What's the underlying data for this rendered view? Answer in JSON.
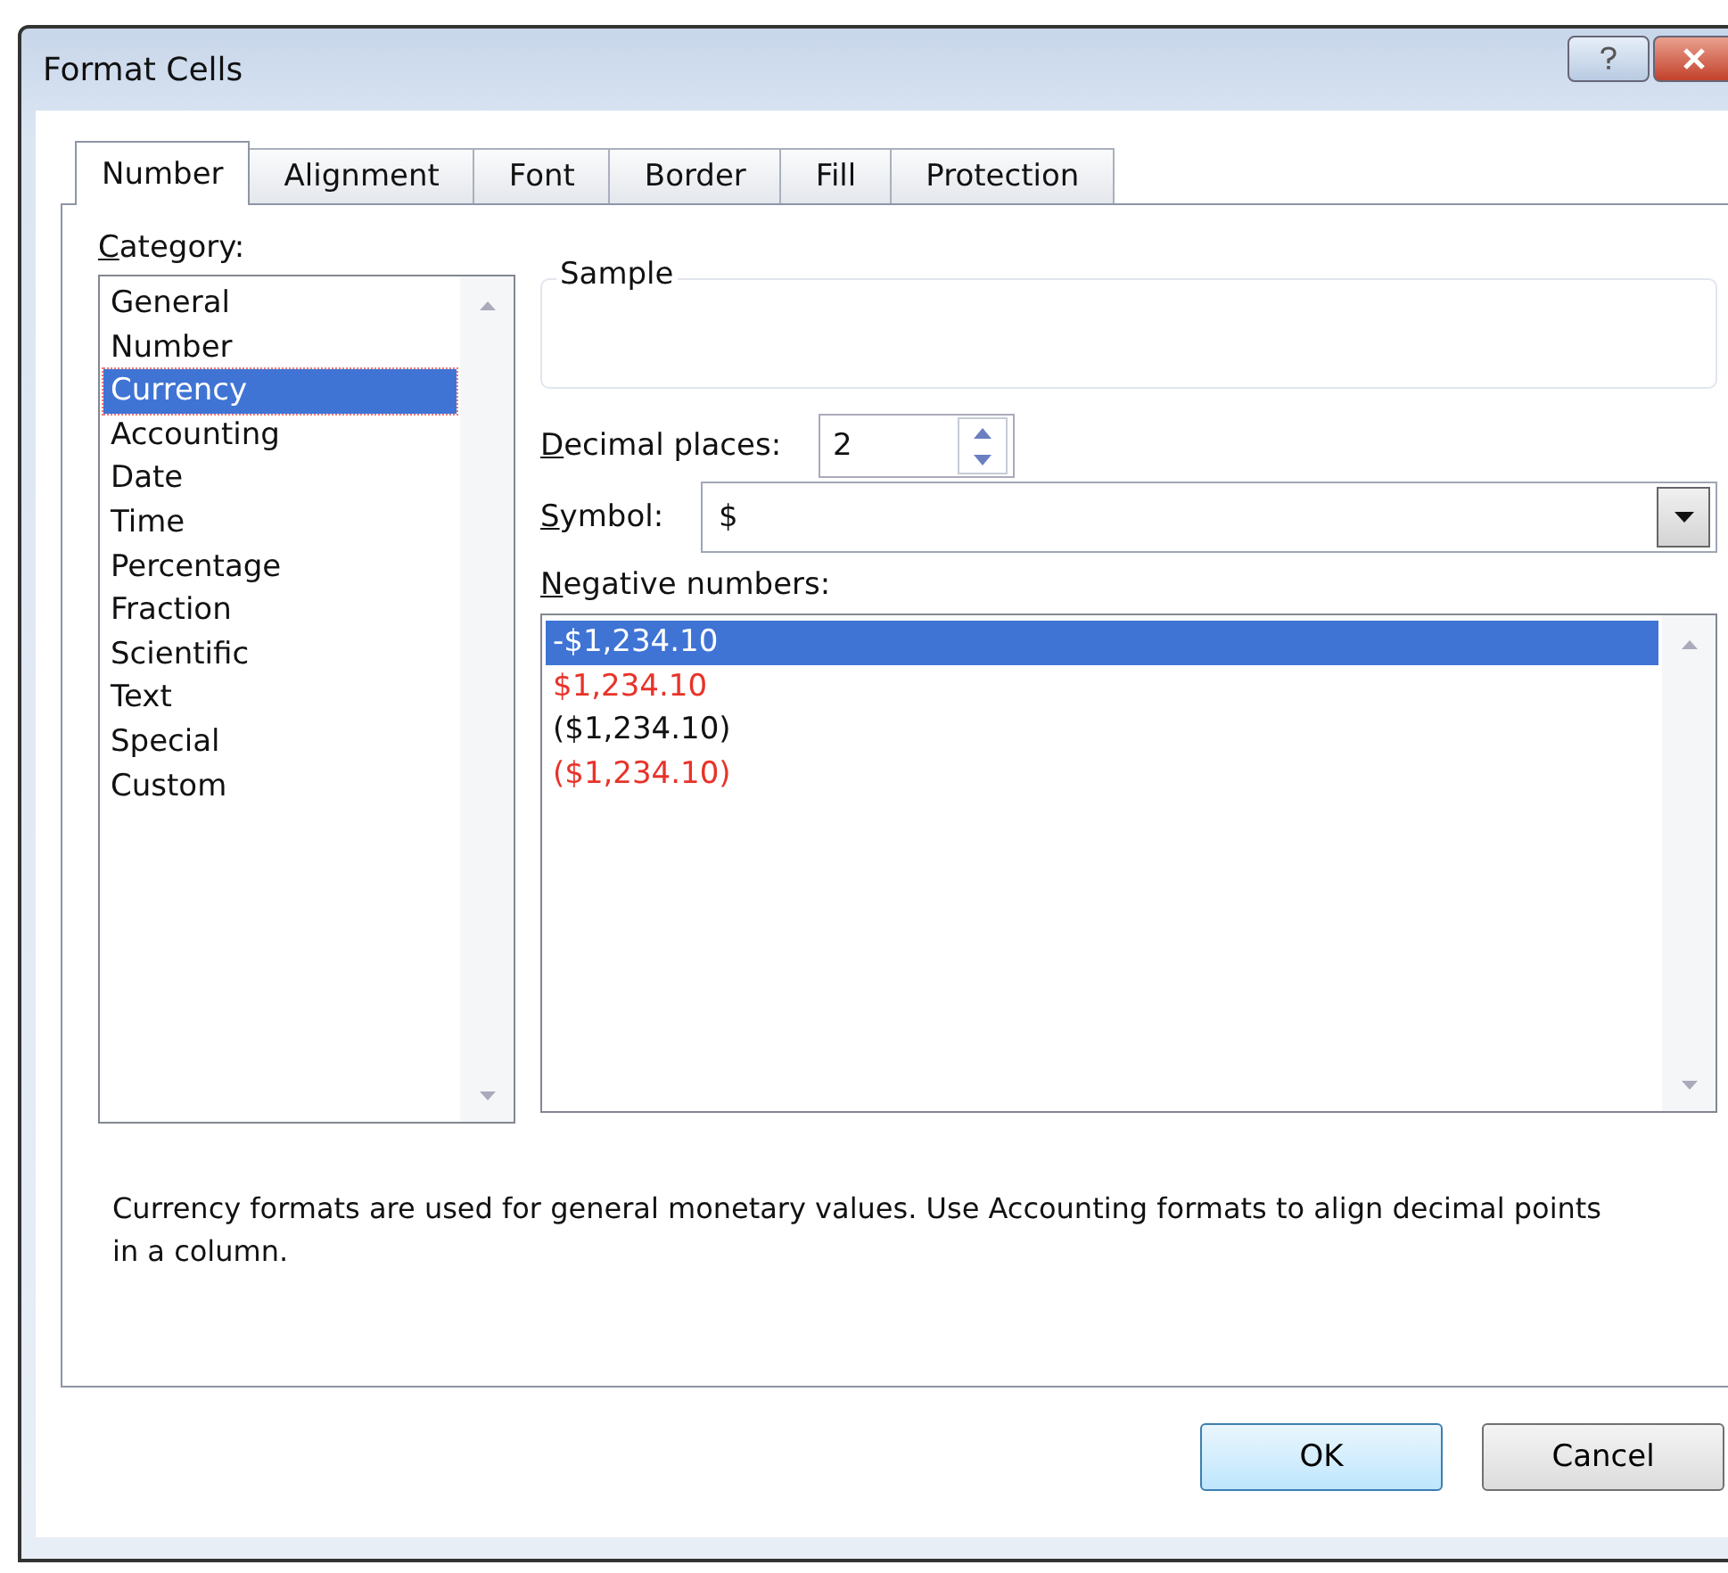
{
  "window": {
    "title": "Format Cells"
  },
  "tabs": [
    {
      "label": "Number",
      "selected": true
    },
    {
      "label": "Alignment",
      "selected": false
    },
    {
      "label": "Font",
      "selected": false
    },
    {
      "label": "Border",
      "selected": false
    },
    {
      "label": "Fill",
      "selected": false
    },
    {
      "label": "Protection",
      "selected": false
    }
  ],
  "category": {
    "label": "Category:",
    "items": [
      {
        "label": "General",
        "selected": false
      },
      {
        "label": "Number",
        "selected": false
      },
      {
        "label": "Currency",
        "selected": true
      },
      {
        "label": "Accounting",
        "selected": false
      },
      {
        "label": "Date",
        "selected": false
      },
      {
        "label": "Time",
        "selected": false
      },
      {
        "label": "Percentage",
        "selected": false
      },
      {
        "label": "Fraction",
        "selected": false
      },
      {
        "label": "Scientific",
        "selected": false
      },
      {
        "label": "Text",
        "selected": false
      },
      {
        "label": "Special",
        "selected": false
      },
      {
        "label": "Custom",
        "selected": false
      }
    ]
  },
  "sample": {
    "label": "Sample"
  },
  "decimal_places": {
    "label": "Decimal places:",
    "value": "2"
  },
  "symbol": {
    "label": "Symbol:",
    "value": "$"
  },
  "negative_numbers": {
    "label": "Negative numbers:",
    "items": [
      {
        "label": "-$1,234.10",
        "selected": true,
        "kind": "plain"
      },
      {
        "label": "$1,234.10",
        "selected": false,
        "kind": "red"
      },
      {
        "label": "($1,234.10)",
        "selected": false,
        "kind": "plain"
      },
      {
        "label": "($1,234.10)",
        "selected": false,
        "kind": "red"
      }
    ]
  },
  "description": "Currency formats are used for general monetary values.  Use Accounting formats to align decimal points in a column.",
  "buttons": [
    "OK",
    "Cancel"
  ]
}
